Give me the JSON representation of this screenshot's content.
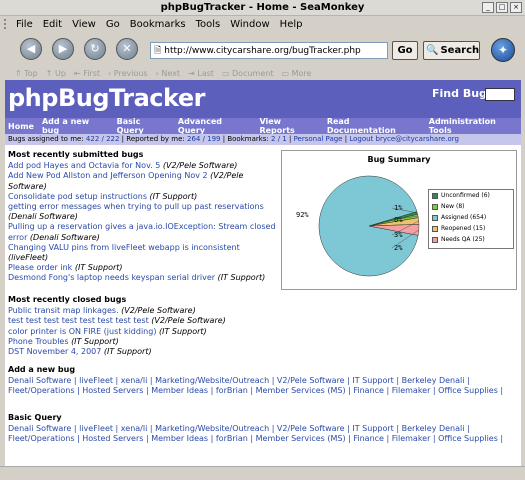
{
  "window": {
    "title": "phpBugTracker - Home - SeaMonkey"
  },
  "menu": [
    "File",
    "Edit",
    "View",
    "Go",
    "Bookmarks",
    "Tools",
    "Window",
    "Help"
  ],
  "toolbar": {
    "url": "http://www.citycarshare.org/bugTracker.php",
    "go": "Go",
    "search": "Search"
  },
  "sitenav": [
    "Top",
    "Up",
    "First",
    "Previous",
    "Next",
    "Last",
    "Document",
    "More"
  ],
  "app": {
    "logo": "phpBugTracker",
    "find_label": "Find Bug"
  },
  "appnav": [
    "Home",
    "Add a new bug",
    "Basic Query",
    "Advanced Query",
    "View Reports",
    "Read Documentation",
    "Administration Tools"
  ],
  "stats": {
    "assigned_label": "Bugs assigned to me:",
    "assigned": "422 / 222",
    "reported_label": "Reported by me:",
    "reported": "264 / 199",
    "bookmarks_label": "Bookmarks:",
    "bookmarks": "2 / 1",
    "personal": "Personal Page",
    "logout": "Logout bryce@citycarshare.org"
  },
  "submitted": {
    "heading": "Most recently submitted bugs",
    "bugs": [
      {
        "title": "Add pod Hayes and Octavia for Nov. 5",
        "project": "(V2/Pele Software)"
      },
      {
        "title": "Add New Pod Allston and Jefferson Opening Nov 2",
        "project": "(V2/Pele Software)"
      },
      {
        "title": "Consolidate pod setup instructions",
        "project": "(IT Support)"
      },
      {
        "title": "getting error messages when trying to pull up past reservations",
        "project": "(Denali Software)"
      },
      {
        "title": "Pulling up a reservation gives a java.io.IOException: Stream closed error",
        "project": "(Denali Software)"
      },
      {
        "title": "Changing VALU pins from liveFleet webapp is inconsistent",
        "project": "(liveFleet)"
      },
      {
        "title": "Please order ink",
        "project": "(IT Support)"
      },
      {
        "title": "Desmond Fong's laptop needs keyspan serial driver",
        "project": "(IT Support)"
      }
    ]
  },
  "closed": {
    "heading": "Most recently closed bugs",
    "bugs": [
      {
        "title": "Public transit map linkages.",
        "project": "(V2/Pele Software)"
      },
      {
        "title": "test test test test test test test test",
        "project": "(V2/Pele Software)"
      },
      {
        "title": "color printer is ON FIRE (just kidding)",
        "project": "(IT Support)"
      },
      {
        "title": "Phone Troubles",
        "project": "(IT Support)"
      },
      {
        "title": "DST November 4, 2007",
        "project": "(IT Support)"
      }
    ]
  },
  "addbug": {
    "heading": "Add a new bug",
    "links": "Denali Software | liveFleet | xena/li | Marketing/Website/Outreach | V2/Pele Software | IT Support | Berkeley Denali | Fleet/Operations | Hosted Servers | Member Ideas | forBrian | Member Services (MS) | Finance | Filemaker | Office Supplies |"
  },
  "basicquery": {
    "heading": "Basic Query",
    "links": "Denali Software | liveFleet | xena/li | Marketing/Website/Outreach | V2/Pele Software | IT Support | Berkeley Denali | Fleet/Operations | Hosted Servers | Member Ideas | forBrian | Member Services (MS) | Finance | Filemaker | Office Supplies |"
  },
  "chart_data": {
    "type": "pie",
    "title": "Bug Summary",
    "slice_labels": [
      "92%",
      "1%",
      "0%",
      "3%",
      "2%"
    ],
    "legend": [
      {
        "label": "Unconfirmed (6)",
        "value": 6,
        "color": "#2e8b57"
      },
      {
        "label": "New (8)",
        "value": 8,
        "color": "#7ccd32"
      },
      {
        "label": "Assigned (654)",
        "value": 654,
        "color": "#7ec8d6"
      },
      {
        "label": "Reopened (15)",
        "value": 15,
        "color": "#f0c070"
      },
      {
        "label": "Needs QA (25)",
        "value": 25,
        "color": "#f4a0a0"
      }
    ],
    "legend_position": "right"
  }
}
